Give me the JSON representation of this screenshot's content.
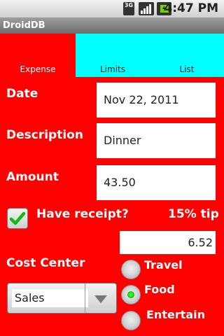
{
  "status_bar": {
    "network_label": "3G",
    "time": "4:47 PM",
    "icons": [
      "network-3g-icon",
      "signal-icon",
      "battery-icon"
    ]
  },
  "app": {
    "title": "DroidDB"
  },
  "tabs": [
    {
      "label": "Expense",
      "selected": true
    },
    {
      "label": "Limits",
      "selected": false
    },
    {
      "label": "List",
      "selected": false
    }
  ],
  "form": {
    "date_label": "Date",
    "date_value": "Nov 22, 2011",
    "description_label": "Description",
    "description_value": "Dinner",
    "amount_label": "Amount",
    "amount_value": "43.50",
    "receipt_label": "Have receipt?",
    "receipt_checked": true,
    "tip_label": "15% tip",
    "tip_value": "6.52",
    "cost_center_label": "Cost Center",
    "cost_center_value": "Sales",
    "category_options": [
      {
        "label": "Travel",
        "selected": false
      },
      {
        "label": "Food",
        "selected": true
      },
      {
        "label": "Entertain",
        "selected": false
      }
    ]
  },
  "colors": {
    "background": "#ff0000",
    "tab_inactive": "#00ffff",
    "text_light": "#ffffff"
  }
}
